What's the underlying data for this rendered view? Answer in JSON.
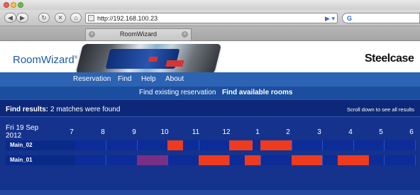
{
  "browser": {
    "url": "http://192.168.100.23",
    "tab_title": "RoomWizard",
    "back_glyph": "◀",
    "forward_glyph": "▶",
    "reload_glyph": "↻",
    "stop_glyph": "✕",
    "home_glyph": "⌂",
    "go_glyph": "▶ ▾",
    "tab_close_glyph": "×",
    "icons": [
      "close-light",
      "minimize-light",
      "zoom-light",
      "back-icon",
      "forward-icon",
      "reload-icon",
      "stop-icon",
      "home-icon",
      "favicon",
      "go-icon",
      "search-icon",
      "tab-close-icon",
      "new-tab-icon"
    ]
  },
  "header": {
    "brand": "RoomWizard",
    "registered": "®",
    "maker": "Steelcase"
  },
  "nav": {
    "items": [
      "Reservation",
      "Find",
      "Help",
      "About"
    ]
  },
  "subnav": {
    "items": [
      "Find existing reservation",
      "Find available rooms"
    ],
    "active_index": 1
  },
  "results": {
    "label": "Find results:",
    "count_text": "2 matches were found",
    "scroll_hint": "Scroll down to see all results",
    "date_day": "Fri 19 Sep",
    "date_year": "2012",
    "hours": [
      "7",
      "8",
      "9",
      "10",
      "11",
      "12",
      "1",
      "2",
      "3",
      "4",
      "5",
      "6"
    ],
    "rooms": [
      {
        "name": "Main_02",
        "bookings": [
          {
            "start": 10.1,
            "end": 10.6,
            "status": "booked"
          },
          {
            "start": 12.1,
            "end": 12.85,
            "status": "booked"
          },
          {
            "start": 13.1,
            "end": 14.1,
            "status": "booked"
          }
        ]
      },
      {
        "name": "Main_01",
        "bookings": [
          {
            "start": 9.1,
            "end": 10.1,
            "status": "pending"
          },
          {
            "start": 11.1,
            "end": 12.1,
            "status": "booked"
          },
          {
            "start": 12.6,
            "end": 13.1,
            "status": "booked"
          },
          {
            "start": 14.1,
            "end": 15.1,
            "status": "booked"
          },
          {
            "start": 15.6,
            "end": 16.6,
            "status": "booked"
          }
        ]
      }
    ]
  },
  "colors": {
    "booked": "#ee3b1f",
    "pending": "#7a2f86",
    "nav": "#2d63b3",
    "panel": "#15338d"
  }
}
